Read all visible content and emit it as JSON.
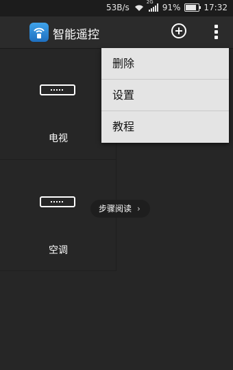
{
  "status_bar": {
    "speed": "53B/s",
    "network": "2G",
    "battery_percent": "91%",
    "battery_level": 0.91,
    "time": "17:32"
  },
  "app_bar": {
    "title": "智能遥控",
    "add_icon": "add-circle-icon",
    "more_icon": "more-vertical-icon",
    "app_icon": "remote-wifi-icon"
  },
  "devices": [
    {
      "label": "电视",
      "icon": "remote-icon"
    },
    {
      "label": "空调",
      "icon": "remote-icon"
    }
  ],
  "tip": {
    "label": "步骤阅读",
    "icon": "chevron-right-icon"
  },
  "menu": {
    "items": [
      {
        "label": "删除"
      },
      {
        "label": "设置"
      },
      {
        "label": "教程"
      }
    ]
  },
  "colors": {
    "background": "#262626",
    "appbar": "#2b2b2b",
    "menu": "#e4e4e4",
    "app_icon_blue": "#2a8ad8"
  }
}
